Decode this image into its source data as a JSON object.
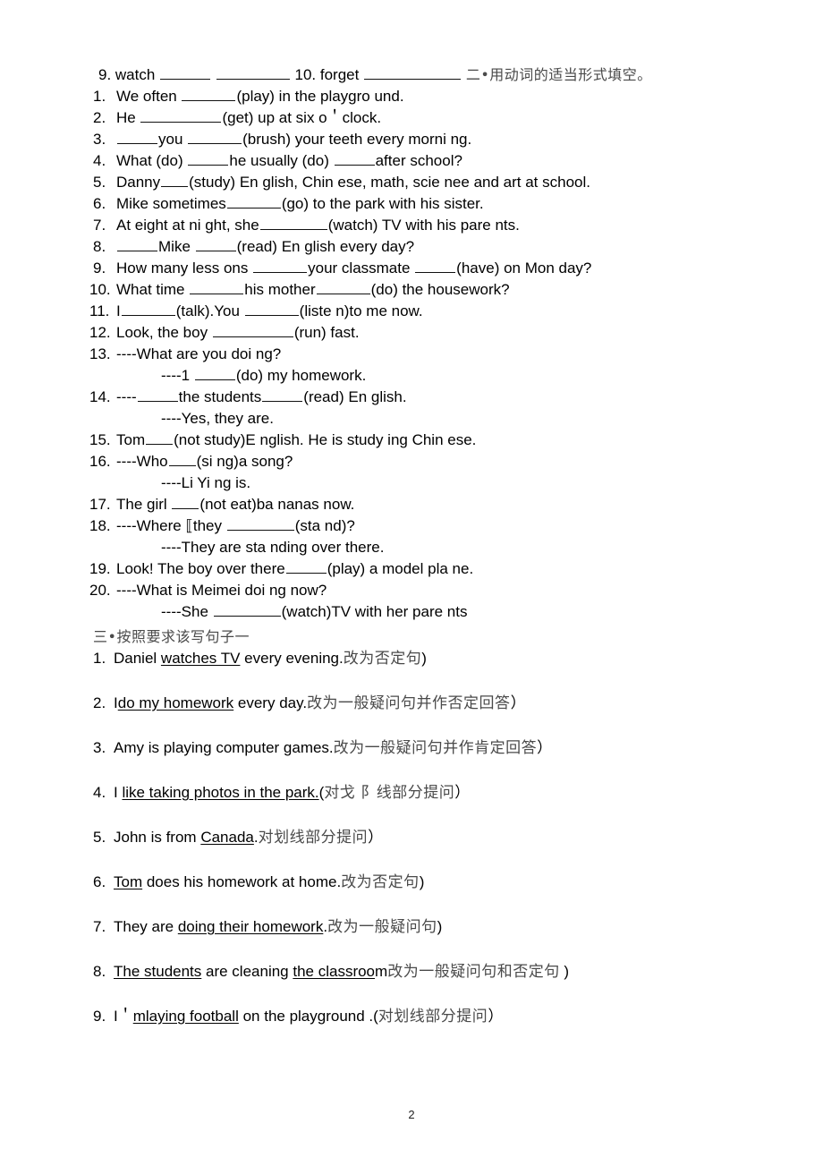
{
  "document": {
    "page_number": "2"
  },
  "section_two": {
    "header": {
      "prefix": "9. watch",
      "blank_a": "",
      "blank_b": "",
      "middle": "10. forget",
      "blank_c": "",
      "heading_cn": "二•用动词的适当形式填空。"
    },
    "items": [
      {
        "num": "1.",
        "parts": [
          "We often ",
          "____",
          "(play) in the playgro und."
        ]
      },
      {
        "num": "2.",
        "parts": [
          "He ",
          "______",
          "(get) up at six o＇clock."
        ]
      },
      {
        "num": "3.",
        "parts": [
          " ",
          "___",
          "you ",
          "____",
          "(brush) your teeth every morni ng."
        ]
      },
      {
        "num": "4.",
        "parts": [
          "What (do) ",
          "___",
          "he usually (do) ",
          "___",
          "after school?"
        ]
      },
      {
        "num": "5.",
        "parts": [
          "Danny",
          "__",
          "(study) En glish, Chin ese, math, scie nee and art at school."
        ]
      },
      {
        "num": "6.",
        "parts": [
          "Mike sometimes",
          "____",
          "(go) to the park with his sister."
        ]
      },
      {
        "num": "7.",
        "parts": [
          "At eight at ni ght, she",
          "_____",
          "(watch) TV with his pare nts."
        ]
      },
      {
        "num": "8.",
        "parts": [
          " ",
          "___",
          "Mike ",
          "___",
          "(read) En glish every day?"
        ]
      },
      {
        "num": "9.",
        "parts": [
          "How many less ons ",
          "____",
          "your classmate ",
          "___",
          "(have) on Mon day?"
        ]
      },
      {
        "num": "10.",
        "parts": [
          "What time ",
          "____",
          "his mother",
          "____",
          "(do) the housework?"
        ]
      },
      {
        "num": "11.",
        "parts": [
          "I",
          "____",
          "(talk).You ",
          "____",
          "(liste n)to me now."
        ]
      },
      {
        "num": "12.",
        "parts": [
          "Look, the boy ",
          "______",
          "(run) fast."
        ]
      },
      {
        "num": "13.",
        "parts": [
          "----What are you doi ng?"
        ],
        "sub": [
          "----1 ",
          "___",
          "(do) my homework."
        ]
      },
      {
        "num": "14.",
        "parts": [
          "----",
          "___",
          "the students",
          "___",
          "(read) En glish."
        ],
        "sub": [
          "----Yes, they are."
        ]
      },
      {
        "num": "15.",
        "parts": [
          "Tom",
          "__",
          "(not study)E nglish. He is study ing Chin ese."
        ]
      },
      {
        "num": "16.",
        "parts": [
          "----Who",
          "__",
          "(si ng)a song?"
        ],
        "sub": [
          "----Li Yi ng is."
        ]
      },
      {
        "num": "17.",
        "parts": [
          "The girl ",
          "__",
          "(not eat)ba nanas now."
        ]
      },
      {
        "num": "18.",
        "parts": [
          "----Where  ",
          "⟦",
          "they ",
          "_____",
          "(sta nd)?"
        ],
        "sub": [
          "----They are sta nding over there."
        ]
      },
      {
        "num": "19.",
        "parts": [
          "Look! The boy over there",
          "___",
          "(play) a model pla ne."
        ]
      },
      {
        "num": "20.",
        "parts": [
          "----What is Meimei doi ng now?"
        ],
        "sub": [
          "----She ",
          "_____",
          "(watch)TV with her pare nts"
        ]
      }
    ]
  },
  "section_three": {
    "title_cn": "三•按照要求该写句子一",
    "items": [
      {
        "num": "1.",
        "before": "Daniel ",
        "underlined": "watches TV",
        "after": " every evening.",
        "cn": "改为否定句",
        "tail": ")"
      },
      {
        "num": "2.",
        "before": "I",
        "underlined": "do my homework",
        "after": " every day.",
        "cn": "改为一般疑问句并作否定回答",
        "tail": "）"
      },
      {
        "num": "3.",
        "before": "Amy is playing computer games.",
        "underlined": "",
        "after": "",
        "cn": "改为一般疑问句并作肯定回答",
        "tail": "）"
      },
      {
        "num": "4.",
        "before": "I ",
        "underlined": "like taking photos in the park.",
        "after": "(",
        "cn": "对戈 阝线部分提问",
        "tail": "）"
      },
      {
        "num": "5.",
        "before": "John is from ",
        "underlined": "Canada",
        "after": ".",
        "cn": "对划线部分提问",
        "tail": "）"
      },
      {
        "num": "6.",
        "before": "",
        "underlined": "Tom",
        "after": " does his homework at home.",
        "cn": "改为否定句",
        "tail": ")"
      },
      {
        "num": "7.",
        "before": "They are ",
        "underlined": "doing their homework",
        "after": ".",
        "cn": "改为一般疑问句",
        "tail": ")"
      },
      {
        "num": "8.",
        "before": "",
        "underlined": "The students",
        "after": " are cleaning ",
        "underlined2": "the classroo",
        "after2": "m",
        "cn": "改为一般疑问句和否定句",
        "tail": " )"
      },
      {
        "num": "9.",
        "before": "I＇",
        "underlined": "mlaying football",
        "after": " on the playground .(",
        "cn": "对划线部分提问",
        "tail": "）"
      }
    ]
  }
}
